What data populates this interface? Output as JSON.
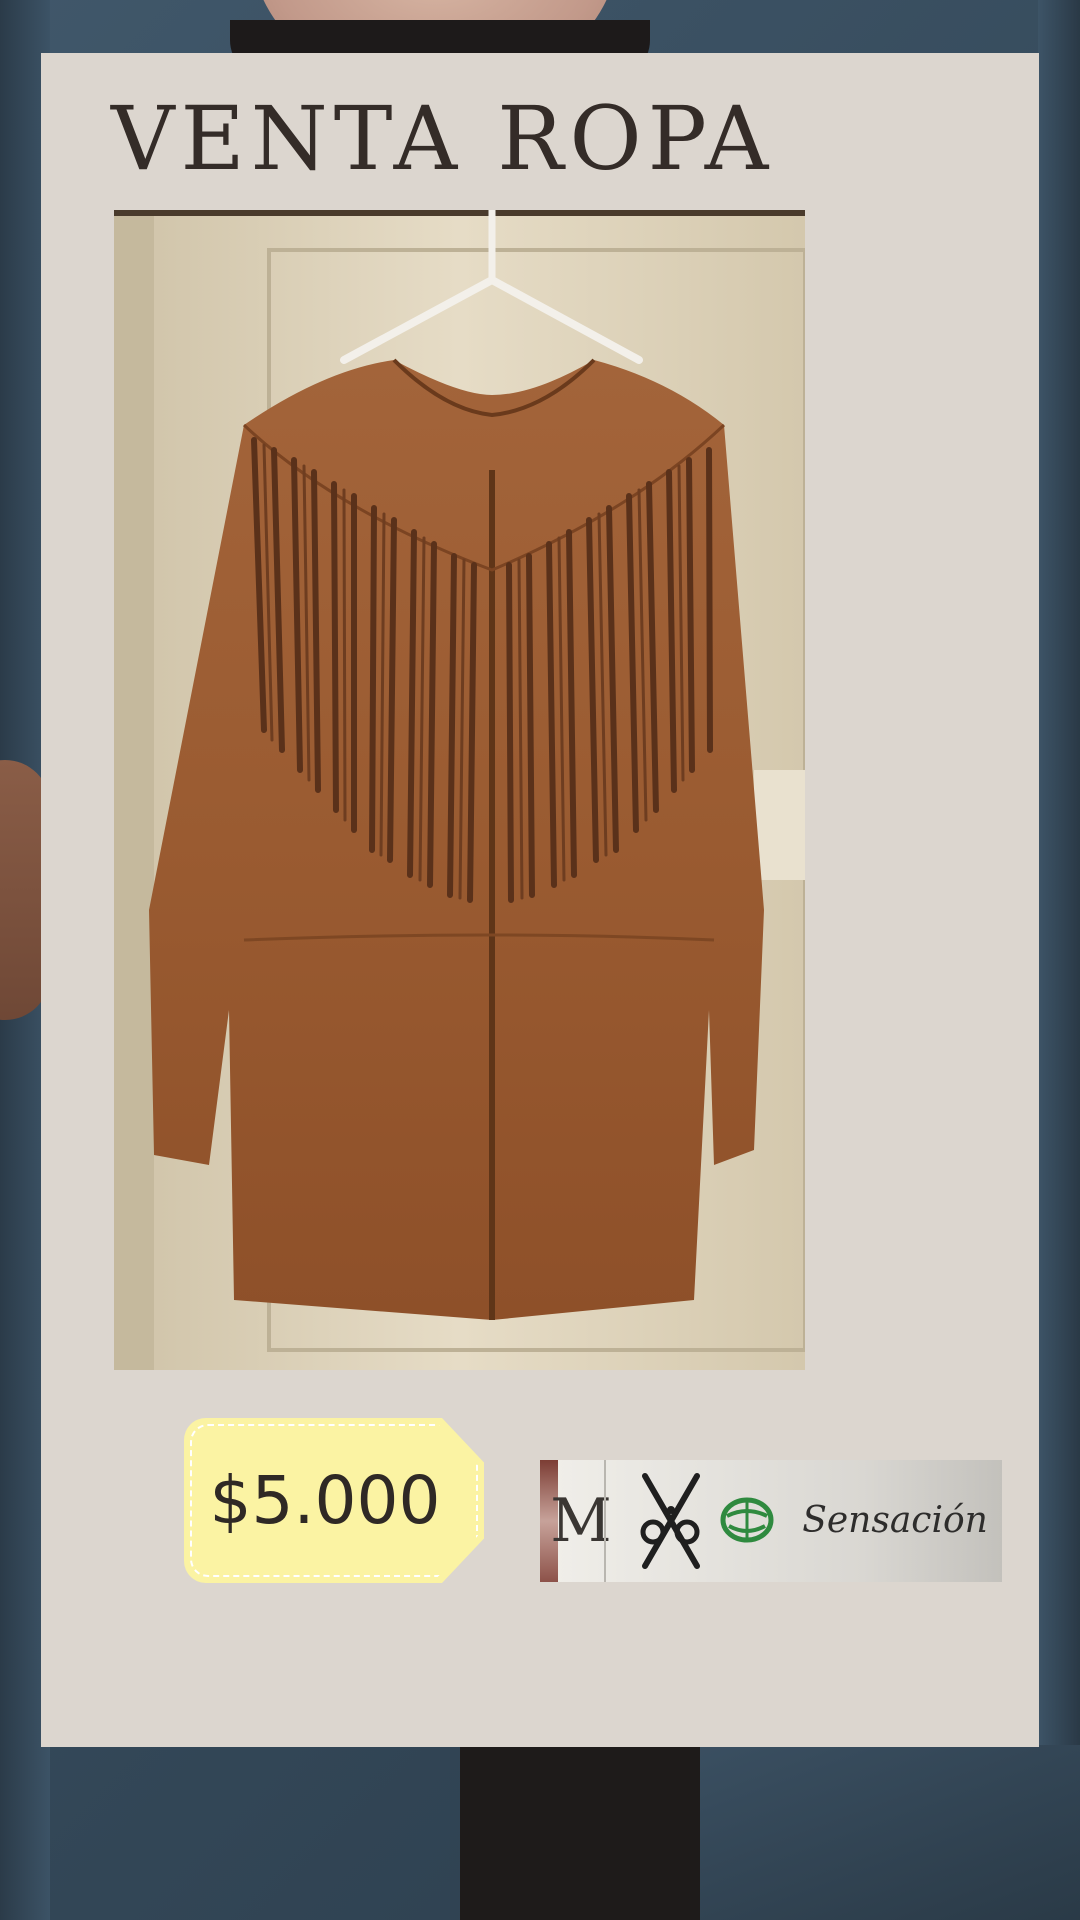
{
  "poster": {
    "title": "VENTA ROPA",
    "price": "$5.000"
  },
  "brand_label": {
    "monogram": "M",
    "name": "Sensación"
  },
  "icons": [
    "scissors-icon",
    "globe-icon",
    "hanger-icon"
  ],
  "colors": {
    "card_background": "#dcd6cf",
    "title": "#342c28",
    "price_tag": "#fbf3a3",
    "jacket": "#9c5a2f",
    "backdrop": "#3a4f61"
  }
}
